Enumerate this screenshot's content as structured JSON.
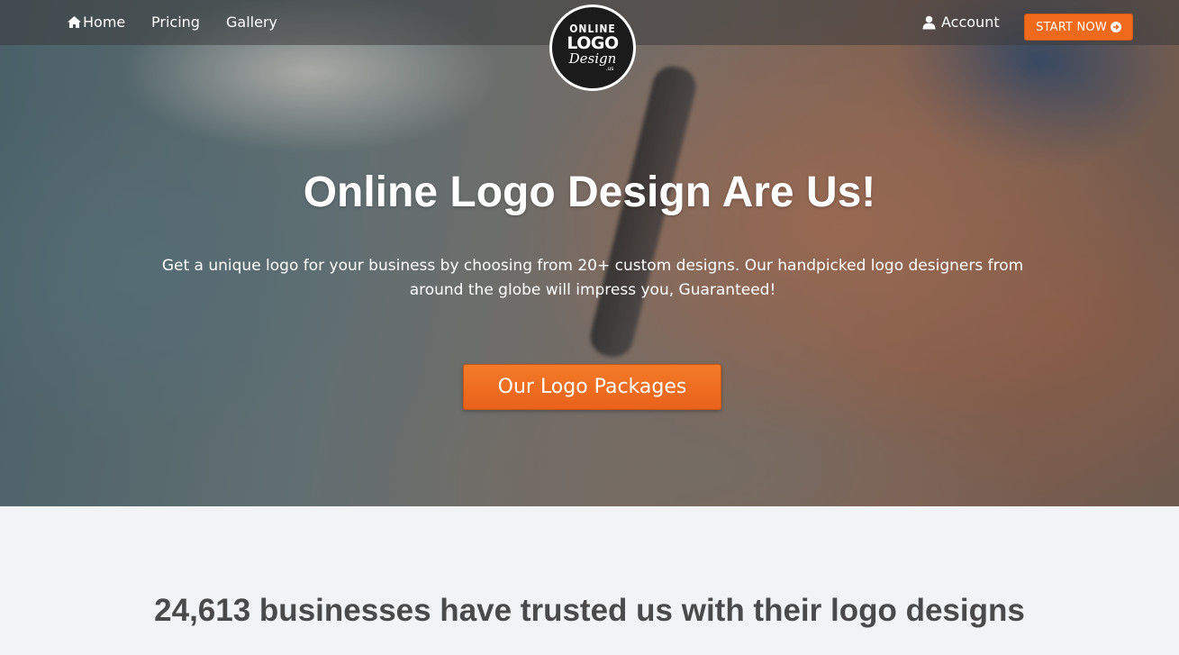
{
  "nav": {
    "home_label": "Home",
    "pricing_label": "Pricing",
    "gallery_label": "Gallery",
    "account_label": "Account",
    "start_label": "START NOW",
    "home_icon": "home-icon",
    "account_icon": "user-icon",
    "start_icon": "arrow-circle-right-icon"
  },
  "logo": {
    "line1": "ONLINE",
    "line2": "LOGO",
    "line3": "Design",
    "line4": ".us"
  },
  "hero": {
    "headline": "Online Logo Design Are Us!",
    "subtext": "Get a unique logo for your business by choosing from 20+ custom designs. Our handpicked logo designers from around the globe will impress you, Guaranteed!",
    "cta_label": "Our Logo Packages"
  },
  "trust": {
    "headline": "24,613 businesses have trusted us with their logo designs"
  },
  "colors": {
    "accent": "#f06a1c",
    "heading_dark": "#4a4a4a",
    "section_bg": "#f2f3f4"
  }
}
